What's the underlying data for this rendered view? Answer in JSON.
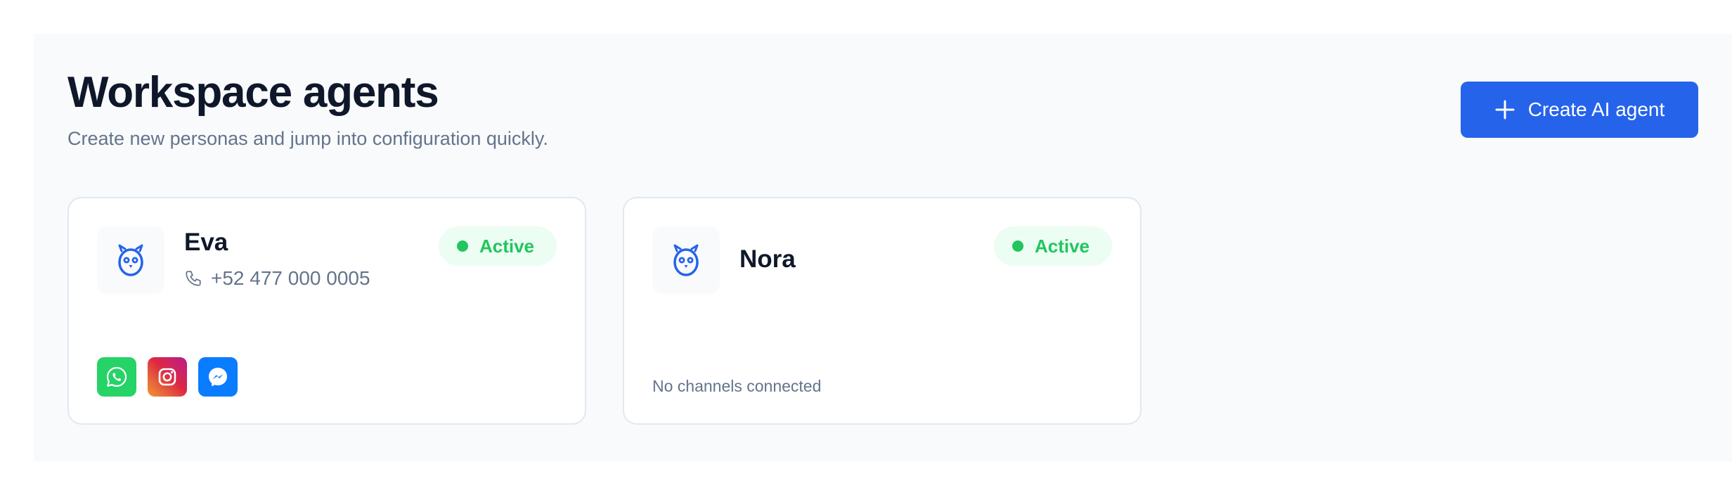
{
  "header": {
    "title": "Workspace agents",
    "subtitle": "Create new personas and jump into configuration quickly.",
    "create_button_label": "Create AI agent",
    "create_button_icon": "plus-icon"
  },
  "colors": {
    "accent": "#2563eb",
    "status_active": "#22c55e",
    "whatsapp": "#25d366",
    "messenger": "#0a7cff"
  },
  "agents": [
    {
      "name": "Eva",
      "status": "Active",
      "phone": "+52 477 000 0005",
      "avatar_icon": "owl-icon",
      "channels": [
        "whatsapp-icon",
        "instagram-icon",
        "messenger-icon"
      ]
    },
    {
      "name": "Nora",
      "status": "Active",
      "avatar_icon": "owl-icon",
      "channels_empty_text": "No channels connected"
    }
  ]
}
